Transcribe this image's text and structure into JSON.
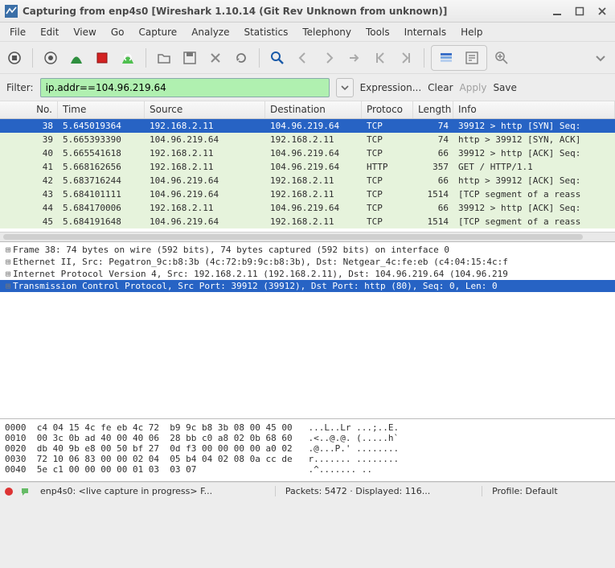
{
  "window": {
    "title": "Capturing from enp4s0   [Wireshark 1.10.14  (Git Rev Unknown from unknown)]"
  },
  "menu": [
    "File",
    "Edit",
    "View",
    "Go",
    "Capture",
    "Analyze",
    "Statistics",
    "Telephony",
    "Tools",
    "Internals",
    "Help"
  ],
  "filterbar": {
    "label": "Filter:",
    "value": "ip.addr==104.96.219.64",
    "expression": "Expression...",
    "clear": "Clear",
    "apply": "Apply",
    "save": "Save"
  },
  "columns": [
    "No.",
    "Time",
    "Source",
    "Destination",
    "Protoco",
    "Length",
    "Info"
  ],
  "packets": [
    {
      "no": "38",
      "time": "5.645019364",
      "src": "192.168.2.11",
      "dst": "104.96.219.64",
      "proto": "TCP",
      "len": "74",
      "info": "39912 > http [SYN] Seq:",
      "cls": "sel"
    },
    {
      "no": "39",
      "time": "5.665393390",
      "src": "104.96.219.64",
      "dst": "192.168.2.11",
      "proto": "TCP",
      "len": "74",
      "info": "http > 39912 [SYN, ACK]",
      "cls": "ack"
    },
    {
      "no": "40",
      "time": "5.665541618",
      "src": "192.168.2.11",
      "dst": "104.96.219.64",
      "proto": "TCP",
      "len": "66",
      "info": "39912 > http [ACK] Seq:",
      "cls": "ack"
    },
    {
      "no": "41",
      "time": "5.668162656",
      "src": "192.168.2.11",
      "dst": "104.96.219.64",
      "proto": "HTTP",
      "len": "357",
      "info": "GET / HTTP/1.1",
      "cls": "http"
    },
    {
      "no": "42",
      "time": "5.683716244",
      "src": "104.96.219.64",
      "dst": "192.168.2.11",
      "proto": "TCP",
      "len": "66",
      "info": "http > 39912 [ACK] Seq:",
      "cls": "ack"
    },
    {
      "no": "43",
      "time": "5.684101111",
      "src": "104.96.219.64",
      "dst": "192.168.2.11",
      "proto": "TCP",
      "len": "1514",
      "info": "[TCP segment of a reass",
      "cls": "seg"
    },
    {
      "no": "44",
      "time": "5.684170006",
      "src": "192.168.2.11",
      "dst": "104.96.219.64",
      "proto": "TCP",
      "len": "66",
      "info": "39912 > http [ACK] Seq:",
      "cls": "ack"
    },
    {
      "no": "45",
      "time": "5.684191648",
      "src": "104.96.219.64",
      "dst": "192.168.2.11",
      "proto": "TCP",
      "len": "1514",
      "info": "[TCP segment of a reass",
      "cls": "seg"
    }
  ],
  "details": [
    {
      "txt": "Frame 38: 74 bytes on wire (592 bits), 74 bytes captured (592 bits) on interface 0",
      "sel": false
    },
    {
      "txt": "Ethernet II, Src: Pegatron_9c:b8:3b (4c:72:b9:9c:b8:3b), Dst: Netgear_4c:fe:eb (c4:04:15:4c:f",
      "sel": false
    },
    {
      "txt": "Internet Protocol Version 4, Src: 192.168.2.11 (192.168.2.11), Dst: 104.96.219.64 (104.96.219",
      "sel": false
    },
    {
      "txt": "Transmission Control Protocol, Src Port: 39912 (39912), Dst Port: http (80), Seq: 0, Len: 0",
      "sel": true
    }
  ],
  "hex": [
    "0000  c4 04 15 4c fe eb 4c 72  b9 9c b8 3b 08 00 45 00   ...L..Lr ...;..E.",
    "0010  00 3c 0b ad 40 00 40 06  28 bb c0 a8 02 0b 68 60   .<..@.@. (.....h`",
    "0020  db 40 9b e8 00 50 bf 27  0d f3 00 00 00 00 a0 02   .@...P.' ........",
    "0030  72 10 06 83 00 00 02 04  05 b4 04 02 08 0a cc de   r....... ........",
    "0040  5e c1 00 00 00 00 01 03  03 07                     .^....... .."
  ],
  "status": {
    "iface": "enp4s0: <live capture in progress> F...",
    "packets": "Packets: 5472 · Displayed: 116...",
    "profile": "Profile: Default"
  }
}
